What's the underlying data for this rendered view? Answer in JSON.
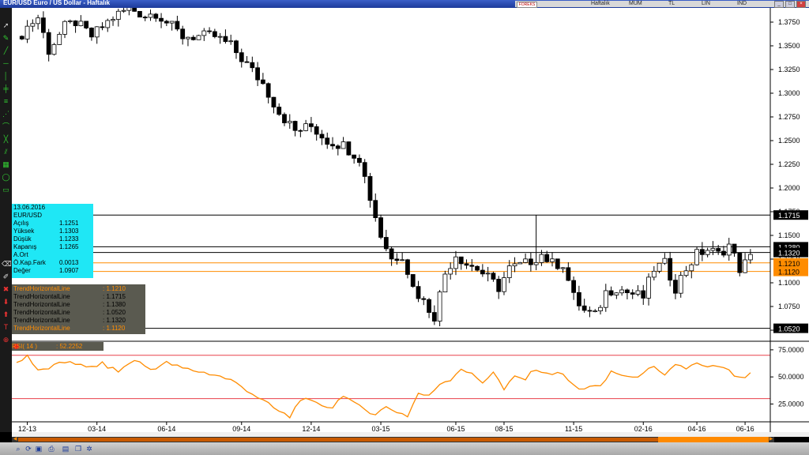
{
  "window": {
    "title": "EUR/USD Euro / US Dollar - Haftalık"
  },
  "toolbar": {
    "forex_badge": "FOREKS",
    "options": [
      "Haftalık",
      "MUM",
      "TL",
      "LIN",
      "IND"
    ],
    "window_buttons": [
      "_",
      "□",
      "×"
    ]
  },
  "info_box": {
    "date": "13.06.2016",
    "symbol": "EUR/USD",
    "rows": [
      {
        "label": "Açılış",
        "value": "1.1251"
      },
      {
        "label": "Yüksek",
        "value": "1.1303"
      },
      {
        "label": "Düşük",
        "value": "1.1233"
      },
      {
        "label": "Kapanış",
        "value": "1.1265"
      },
      {
        "label": "A.Ort",
        "value": ""
      },
      {
        "label": "Ö.Kap.Fark",
        "value": "0.0013"
      },
      {
        "label": "Değer",
        "value": "1.0907"
      }
    ]
  },
  "trend_lines_legend": [
    {
      "name": "TrendHorizontalLine",
      "value": ": 1.1210",
      "color": "#ff8c00"
    },
    {
      "name": "TrendHorizontalLine",
      "value": ": 1.1715",
      "color": "#000000"
    },
    {
      "name": "TrendHorizontalLine",
      "value": ": 1.1380",
      "color": "#000000"
    },
    {
      "name": "TrendHorizontalLine",
      "value": ": 1.0520",
      "color": "#000000"
    },
    {
      "name": "TrendHorizontalLine",
      "value": ": 1.1320",
      "color": "#000000"
    },
    {
      "name": "TrendHorizontalLine",
      "value": ": 1.1120",
      "color": "#ff8c00"
    }
  ],
  "rsi_label": {
    "name": "RSI( 14 )",
    "value": ": 52.2252"
  },
  "price_axis": {
    "ticks": [
      "1.3750",
      "1.3500",
      "1.3250",
      "1.3000",
      "1.2750",
      "1.2500",
      "1.2250",
      "1.2000",
      "1.1750",
      "1.1500",
      "1.1250",
      "1.1000",
      "1.0750",
      "1.0500"
    ],
    "tags": [
      {
        "label": "1.1715",
        "price": 1.1715,
        "style": "black"
      },
      {
        "label": "1.1380",
        "price": 1.138,
        "style": "black"
      },
      {
        "label": "1.1320",
        "price": 1.132,
        "style": "black"
      },
      {
        "label": "1.1210",
        "price": 1.121,
        "style": "orange"
      },
      {
        "label": "1.1120",
        "price": 1.112,
        "style": "orange"
      },
      {
        "label": "1.0520",
        "price": 1.052,
        "style": "black"
      }
    ]
  },
  "rsi_axis": {
    "ticks": [
      "75.0000",
      "50.0000",
      "25.0000"
    ]
  },
  "time_axis": {
    "ticks": [
      "12-13",
      "03-14",
      "06-14",
      "09-14",
      "12-14",
      "03-15",
      "06-15",
      "08-15",
      "11-15",
      "02-16",
      "04-16",
      "06-16"
    ]
  },
  "colors": {
    "orange": "#ff8c00",
    "rsi_band": "#e8404a",
    "panel_bg": "#5a5a50",
    "info_bg": "#1fe7f5",
    "toolbar_blue": "#1c3a9a"
  },
  "chart_data": {
    "type": "candlestick",
    "title": "EUR/USD Euro / US Dollar - Haftalık",
    "period": "weekly",
    "price_range": [
      1.04,
      1.39
    ],
    "x_labels": [
      "12-13",
      "03-14",
      "06-14",
      "09-14",
      "12-14",
      "03-15",
      "06-15",
      "08-15",
      "11-15",
      "02-16",
      "04-16",
      "06-16"
    ],
    "x_label_positions": [
      2,
      15,
      28,
      42,
      55,
      68,
      82,
      91,
      104,
      117,
      127,
      136
    ],
    "anchors": [
      [
        0,
        1.355
      ],
      [
        2,
        1.37
      ],
      [
        4,
        1.38
      ],
      [
        6,
        1.345
      ],
      [
        9,
        1.37
      ],
      [
        11,
        1.375
      ],
      [
        14,
        1.36
      ],
      [
        16,
        1.37
      ],
      [
        18,
        1.38
      ],
      [
        21,
        1.39
      ],
      [
        24,
        1.382
      ],
      [
        26,
        1.385
      ],
      [
        28,
        1.375
      ],
      [
        31,
        1.36
      ],
      [
        34,
        1.36
      ],
      [
        37,
        1.36
      ],
      [
        40,
        1.35
      ],
      [
        43,
        1.33
      ],
      [
        46,
        1.31
      ],
      [
        49,
        1.28
      ],
      [
        52,
        1.26
      ],
      [
        55,
        1.265
      ],
      [
        58,
        1.25
      ],
      [
        61,
        1.245
      ],
      [
        64,
        1.232
      ],
      [
        66,
        1.19
      ],
      [
        68,
        1.15
      ],
      [
        70,
        1.125
      ],
      [
        72,
        1.13
      ],
      [
        74,
        1.095
      ],
      [
        76,
        1.08
      ],
      [
        78,
        1.065
      ],
      [
        80,
        1.11
      ],
      [
        82,
        1.13
      ],
      [
        84,
        1.12
      ],
      [
        86,
        1.115
      ],
      [
        88,
        1.105
      ],
      [
        90,
        1.095
      ],
      [
        92,
        1.115
      ],
      [
        95,
        1.12
      ],
      [
        98,
        1.13
      ],
      [
        100,
        1.12
      ],
      [
        102,
        1.12
      ],
      [
        104,
        1.085
      ],
      [
        106,
        1.07
      ],
      [
        108,
        1.065
      ],
      [
        110,
        1.09
      ],
      [
        112,
        1.095
      ],
      [
        114,
        1.09
      ],
      [
        117,
        1.085
      ],
      [
        119,
        1.115
      ],
      [
        121,
        1.12
      ],
      [
        123,
        1.095
      ],
      [
        125,
        1.115
      ],
      [
        127,
        1.13
      ],
      [
        129,
        1.135
      ],
      [
        131,
        1.13
      ],
      [
        133,
        1.14
      ],
      [
        135,
        1.115
      ],
      [
        137,
        1.126
      ]
    ],
    "highlights": [
      {
        "index": 97,
        "high": 1.1715
      }
    ],
    "horizontal_lines": [
      {
        "price": 1.1715,
        "color": "black"
      },
      {
        "price": 1.138,
        "color": "black"
      },
      {
        "price": 1.132,
        "color": "black"
      },
      {
        "price": 1.121,
        "color": "orange"
      },
      {
        "price": 1.112,
        "color": "orange"
      },
      {
        "price": 1.052,
        "color": "black"
      }
    ],
    "rsi": {
      "period": 14,
      "last": 52.2252,
      "bands": [
        70,
        30
      ],
      "range": [
        10,
        80
      ],
      "anchors": [
        [
          0,
          63
        ],
        [
          2,
          70
        ],
        [
          4,
          55
        ],
        [
          7,
          60
        ],
        [
          10,
          65
        ],
        [
          13,
          58
        ],
        [
          16,
          62
        ],
        [
          19,
          55
        ],
        [
          22,
          66
        ],
        [
          25,
          57
        ],
        [
          28,
          63
        ],
        [
          31,
          58
        ],
        [
          34,
          55
        ],
        [
          37,
          52
        ],
        [
          40,
          47
        ],
        [
          43,
          38
        ],
        [
          46,
          28
        ],
        [
          49,
          18
        ],
        [
          51,
          13
        ],
        [
          53,
          30
        ],
        [
          56,
          25
        ],
        [
          59,
          22
        ],
        [
          61,
          34
        ],
        [
          63,
          25
        ],
        [
          65,
          20
        ],
        [
          67,
          16
        ],
        [
          69,
          22
        ],
        [
          71,
          18
        ],
        [
          73,
          14
        ],
        [
          75,
          35
        ],
        [
          77,
          32
        ],
        [
          79,
          44
        ],
        [
          81,
          48
        ],
        [
          83,
          58
        ],
        [
          85,
          52
        ],
        [
          87,
          45
        ],
        [
          89,
          55
        ],
        [
          91,
          38
        ],
        [
          93,
          50
        ],
        [
          95,
          48
        ],
        [
          97,
          58
        ],
        [
          99,
          52
        ],
        [
          101,
          55
        ],
        [
          103,
          47
        ],
        [
          105,
          38
        ],
        [
          107,
          42
        ],
        [
          109,
          40
        ],
        [
          111,
          55
        ],
        [
          113,
          52
        ],
        [
          115,
          48
        ],
        [
          117,
          55
        ],
        [
          119,
          58
        ],
        [
          121,
          50
        ],
        [
          123,
          62
        ],
        [
          125,
          58
        ],
        [
          127,
          62
        ],
        [
          129,
          58
        ],
        [
          131,
          60
        ],
        [
          133,
          55
        ],
        [
          135,
          48
        ],
        [
          137,
          52
        ]
      ]
    }
  }
}
